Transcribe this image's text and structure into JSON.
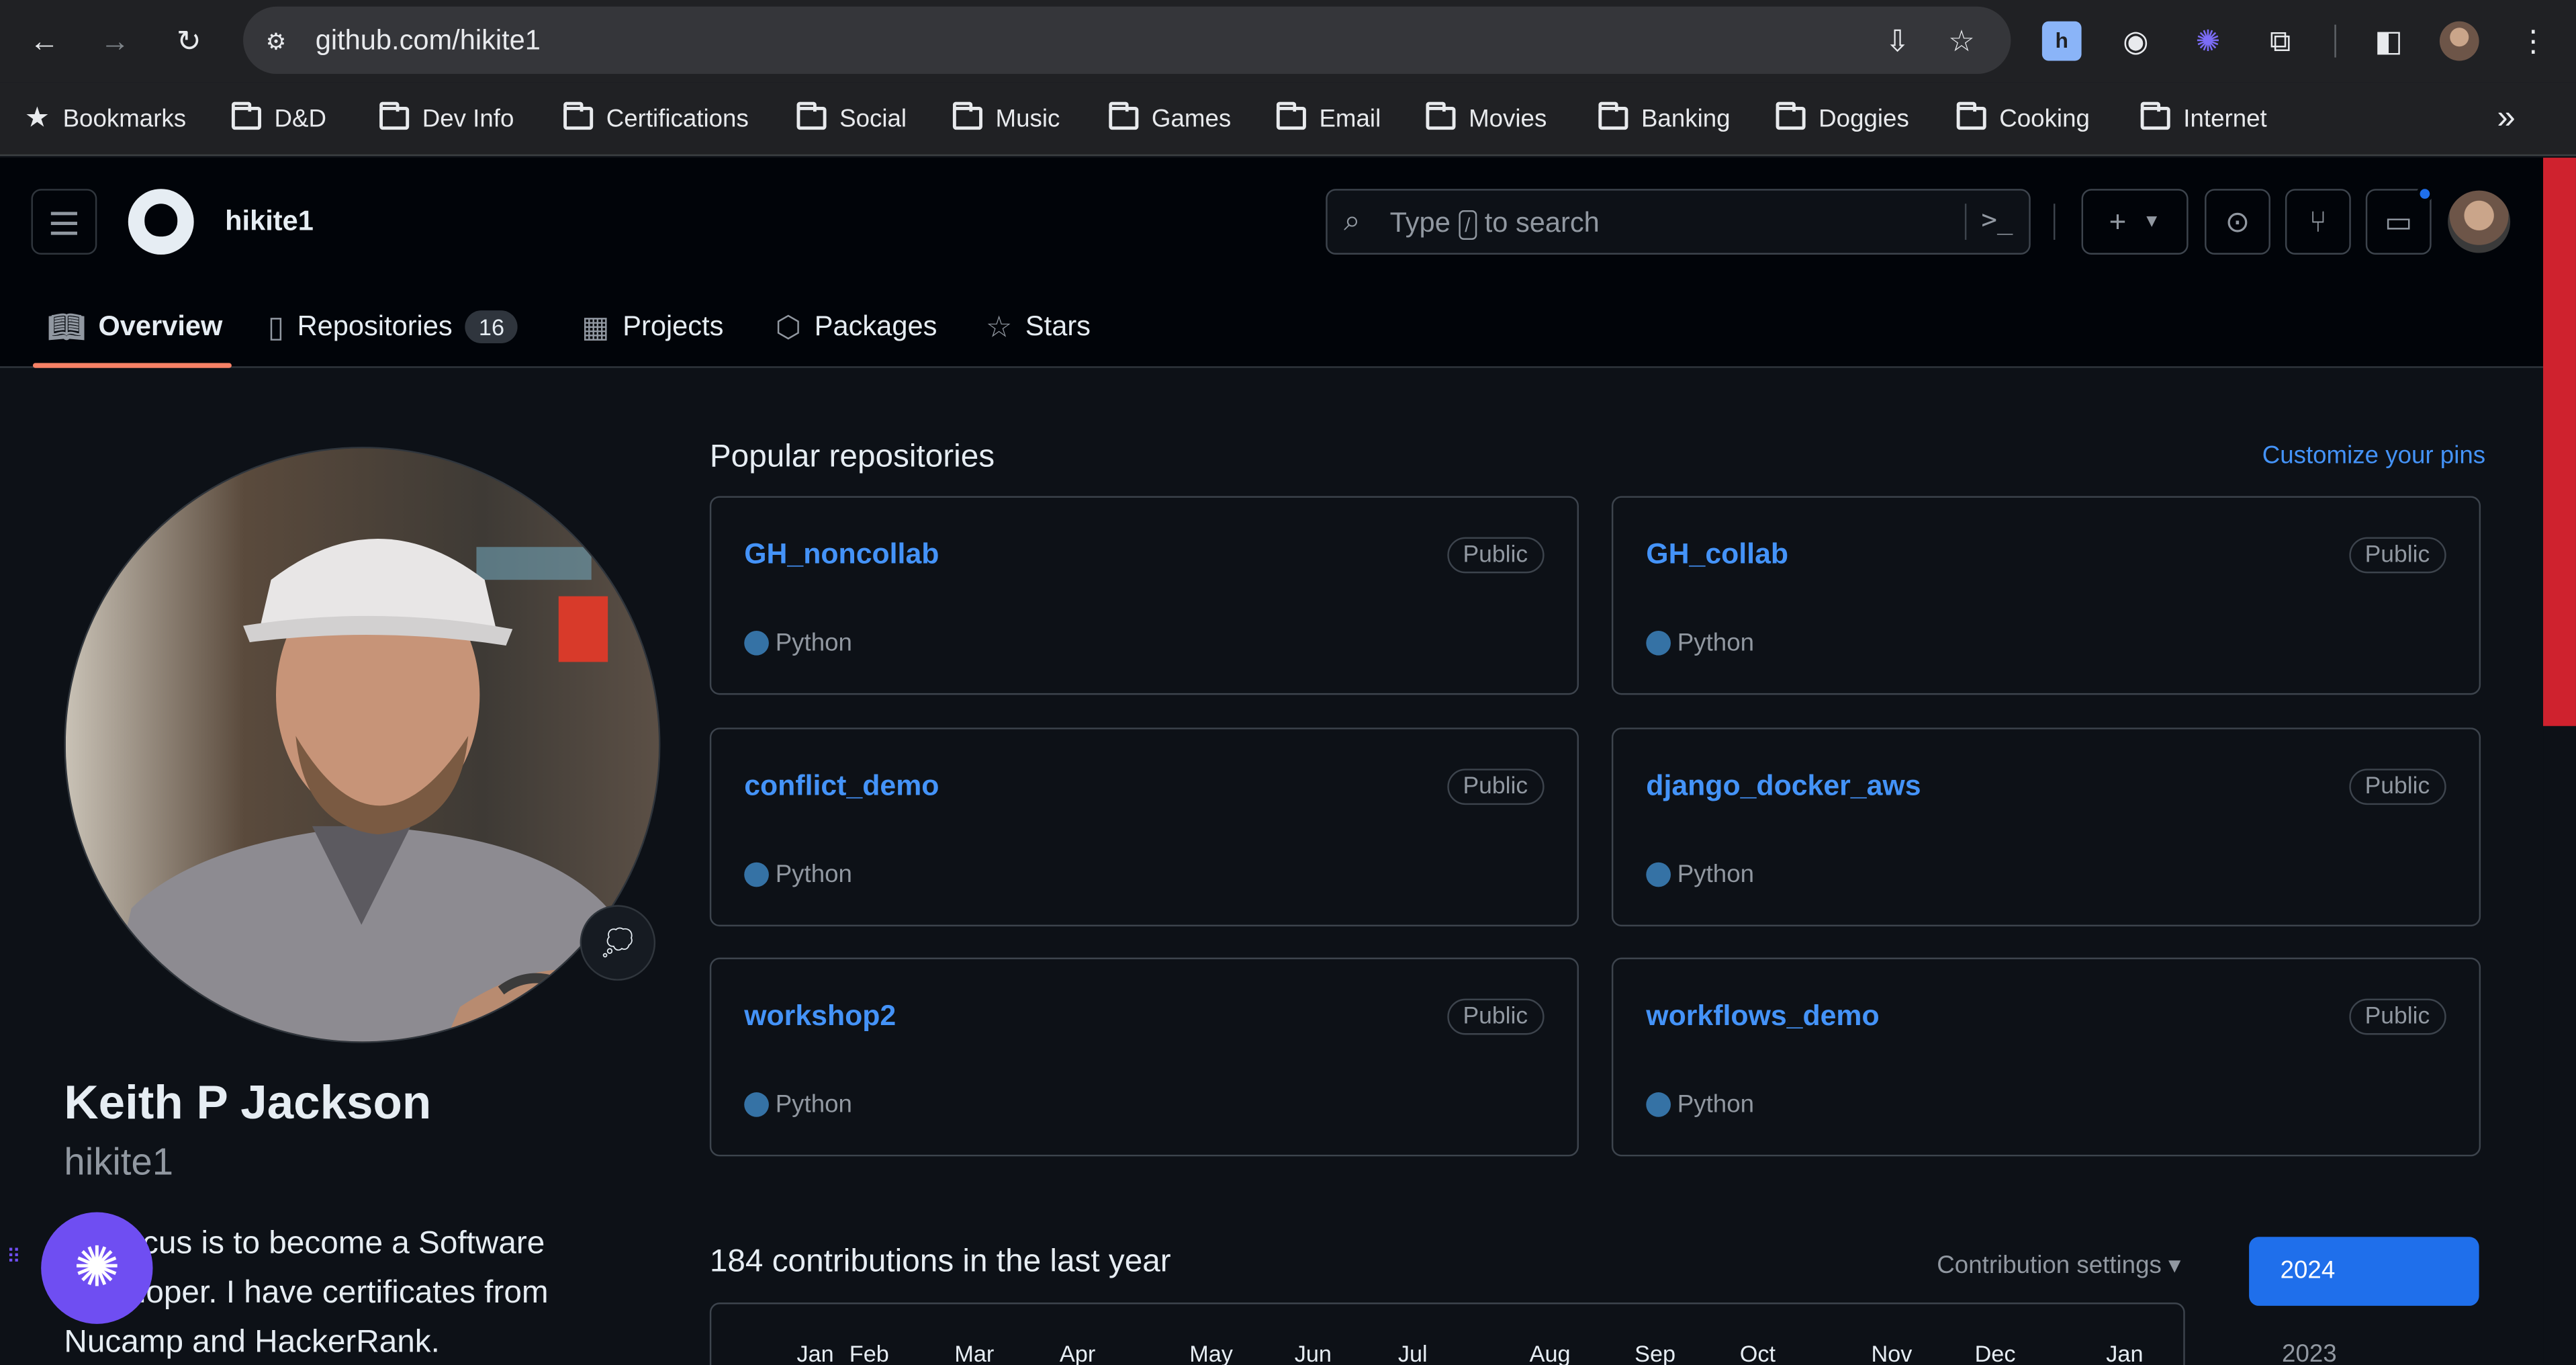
{
  "browser": {
    "url": "github.com/hikite1",
    "bookmarks": [
      "Bookmarks",
      "D&D",
      "Dev Info",
      "Certifications",
      "Social",
      "Music",
      "Games",
      "Email",
      "Movies",
      "Banking",
      "Doggies",
      "Cooking",
      "Internet"
    ]
  },
  "header": {
    "username": "hikite1",
    "search_prefix": "Type",
    "search_key": "/",
    "search_suffix": "to search",
    "create_label": "+"
  },
  "tabs": [
    {
      "label": "Overview"
    },
    {
      "label": "Repositories",
      "count": "16"
    },
    {
      "label": "Projects"
    },
    {
      "label": "Packages"
    },
    {
      "label": "Stars"
    }
  ],
  "profile": {
    "name": "Keith P Jackson",
    "login": "hikite1",
    "bio": "My focus is to become a Software Developer. I have certificates from Nucamp and HackerRank."
  },
  "popular": {
    "title": "Popular repositories",
    "customize": "Customize your pins",
    "repos": [
      {
        "name": "GH_noncollab",
        "visibility": "Public",
        "language": "Python"
      },
      {
        "name": "GH_collab",
        "visibility": "Public",
        "language": "Python"
      },
      {
        "name": "conflict_demo",
        "visibility": "Public",
        "language": "Python"
      },
      {
        "name": "django_docker_aws",
        "visibility": "Public",
        "language": "Python"
      },
      {
        "name": "workshop2",
        "visibility": "Public",
        "language": "Python"
      },
      {
        "name": "workflows_demo",
        "visibility": "Public",
        "language": "Python"
      }
    ]
  },
  "contributions": {
    "title": "184 contributions in the last year",
    "settings": "Contribution settings ▾",
    "years": [
      "2024",
      "2023"
    ],
    "months": [
      "Jan",
      "Feb",
      "Mar",
      "Apr",
      "May",
      "Jun",
      "Jul",
      "Aug",
      "Sep",
      "Oct",
      "Nov",
      "Dec",
      "Jan"
    ]
  },
  "colors": {
    "link": "#4493f8",
    "python": "#3572A5",
    "tab_underline": "#f78166",
    "assistant": "#6f4ef2"
  }
}
